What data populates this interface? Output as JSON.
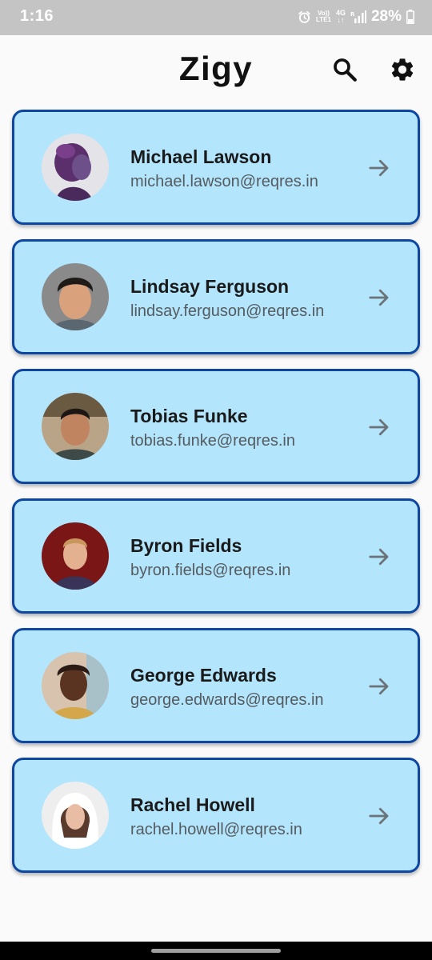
{
  "status_bar": {
    "time": "1:16",
    "volte_top": "Vo))",
    "volte_bottom": "LTE1",
    "network_top": "4G",
    "network_bottom": "↓↑",
    "battery": "28%",
    "icons": [
      "alarm-icon",
      "signal-icon",
      "battery-icon"
    ]
  },
  "app_bar": {
    "title": "Zigy",
    "icons": [
      "search-icon",
      "settings-icon"
    ]
  },
  "users": [
    {
      "name": "Michael Lawson",
      "email": "michael.lawson@reqres.in"
    },
    {
      "name": "Lindsay Ferguson",
      "email": "lindsay.ferguson@reqres.in"
    },
    {
      "name": "Tobias Funke",
      "email": "tobias.funke@reqres.in"
    },
    {
      "name": "Byron Fields",
      "email": "byron.fields@reqres.in"
    },
    {
      "name": "George Edwards",
      "email": "george.edwards@reqres.in"
    },
    {
      "name": "Rachel Howell",
      "email": "rachel.howell@reqres.in"
    }
  ],
  "colors": {
    "card_background": "#b3e5fc",
    "card_border": "#0d47a1",
    "status_bar": "#c4c4c4",
    "page_background": "#fafafa"
  }
}
